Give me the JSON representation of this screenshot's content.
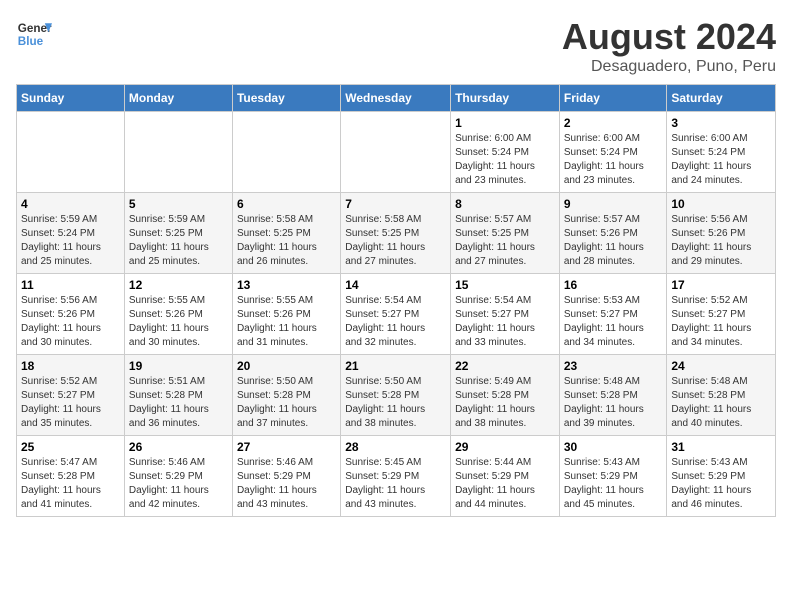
{
  "header": {
    "logo_line1": "General",
    "logo_line2": "Blue",
    "main_title": "August 2024",
    "subtitle": "Desaguadero, Puno, Peru"
  },
  "weekdays": [
    "Sunday",
    "Monday",
    "Tuesday",
    "Wednesday",
    "Thursday",
    "Friday",
    "Saturday"
  ],
  "weeks": [
    [
      {
        "day": "",
        "info": ""
      },
      {
        "day": "",
        "info": ""
      },
      {
        "day": "",
        "info": ""
      },
      {
        "day": "",
        "info": ""
      },
      {
        "day": "1",
        "info": "Sunrise: 6:00 AM\nSunset: 5:24 PM\nDaylight: 11 hours\nand 23 minutes."
      },
      {
        "day": "2",
        "info": "Sunrise: 6:00 AM\nSunset: 5:24 PM\nDaylight: 11 hours\nand 23 minutes."
      },
      {
        "day": "3",
        "info": "Sunrise: 6:00 AM\nSunset: 5:24 PM\nDaylight: 11 hours\nand 24 minutes."
      }
    ],
    [
      {
        "day": "4",
        "info": "Sunrise: 5:59 AM\nSunset: 5:24 PM\nDaylight: 11 hours\nand 25 minutes."
      },
      {
        "day": "5",
        "info": "Sunrise: 5:59 AM\nSunset: 5:25 PM\nDaylight: 11 hours\nand 25 minutes."
      },
      {
        "day": "6",
        "info": "Sunrise: 5:58 AM\nSunset: 5:25 PM\nDaylight: 11 hours\nand 26 minutes."
      },
      {
        "day": "7",
        "info": "Sunrise: 5:58 AM\nSunset: 5:25 PM\nDaylight: 11 hours\nand 27 minutes."
      },
      {
        "day": "8",
        "info": "Sunrise: 5:57 AM\nSunset: 5:25 PM\nDaylight: 11 hours\nand 27 minutes."
      },
      {
        "day": "9",
        "info": "Sunrise: 5:57 AM\nSunset: 5:26 PM\nDaylight: 11 hours\nand 28 minutes."
      },
      {
        "day": "10",
        "info": "Sunrise: 5:56 AM\nSunset: 5:26 PM\nDaylight: 11 hours\nand 29 minutes."
      }
    ],
    [
      {
        "day": "11",
        "info": "Sunrise: 5:56 AM\nSunset: 5:26 PM\nDaylight: 11 hours\nand 30 minutes."
      },
      {
        "day": "12",
        "info": "Sunrise: 5:55 AM\nSunset: 5:26 PM\nDaylight: 11 hours\nand 30 minutes."
      },
      {
        "day": "13",
        "info": "Sunrise: 5:55 AM\nSunset: 5:26 PM\nDaylight: 11 hours\nand 31 minutes."
      },
      {
        "day": "14",
        "info": "Sunrise: 5:54 AM\nSunset: 5:27 PM\nDaylight: 11 hours\nand 32 minutes."
      },
      {
        "day": "15",
        "info": "Sunrise: 5:54 AM\nSunset: 5:27 PM\nDaylight: 11 hours\nand 33 minutes."
      },
      {
        "day": "16",
        "info": "Sunrise: 5:53 AM\nSunset: 5:27 PM\nDaylight: 11 hours\nand 34 minutes."
      },
      {
        "day": "17",
        "info": "Sunrise: 5:52 AM\nSunset: 5:27 PM\nDaylight: 11 hours\nand 34 minutes."
      }
    ],
    [
      {
        "day": "18",
        "info": "Sunrise: 5:52 AM\nSunset: 5:27 PM\nDaylight: 11 hours\nand 35 minutes."
      },
      {
        "day": "19",
        "info": "Sunrise: 5:51 AM\nSunset: 5:28 PM\nDaylight: 11 hours\nand 36 minutes."
      },
      {
        "day": "20",
        "info": "Sunrise: 5:50 AM\nSunset: 5:28 PM\nDaylight: 11 hours\nand 37 minutes."
      },
      {
        "day": "21",
        "info": "Sunrise: 5:50 AM\nSunset: 5:28 PM\nDaylight: 11 hours\nand 38 minutes."
      },
      {
        "day": "22",
        "info": "Sunrise: 5:49 AM\nSunset: 5:28 PM\nDaylight: 11 hours\nand 38 minutes."
      },
      {
        "day": "23",
        "info": "Sunrise: 5:48 AM\nSunset: 5:28 PM\nDaylight: 11 hours\nand 39 minutes."
      },
      {
        "day": "24",
        "info": "Sunrise: 5:48 AM\nSunset: 5:28 PM\nDaylight: 11 hours\nand 40 minutes."
      }
    ],
    [
      {
        "day": "25",
        "info": "Sunrise: 5:47 AM\nSunset: 5:28 PM\nDaylight: 11 hours\nand 41 minutes."
      },
      {
        "day": "26",
        "info": "Sunrise: 5:46 AM\nSunset: 5:29 PM\nDaylight: 11 hours\nand 42 minutes."
      },
      {
        "day": "27",
        "info": "Sunrise: 5:46 AM\nSunset: 5:29 PM\nDaylight: 11 hours\nand 43 minutes."
      },
      {
        "day": "28",
        "info": "Sunrise: 5:45 AM\nSunset: 5:29 PM\nDaylight: 11 hours\nand 43 minutes."
      },
      {
        "day": "29",
        "info": "Sunrise: 5:44 AM\nSunset: 5:29 PM\nDaylight: 11 hours\nand 44 minutes."
      },
      {
        "day": "30",
        "info": "Sunrise: 5:43 AM\nSunset: 5:29 PM\nDaylight: 11 hours\nand 45 minutes."
      },
      {
        "day": "31",
        "info": "Sunrise: 5:43 AM\nSunset: 5:29 PM\nDaylight: 11 hours\nand 46 minutes."
      }
    ]
  ]
}
